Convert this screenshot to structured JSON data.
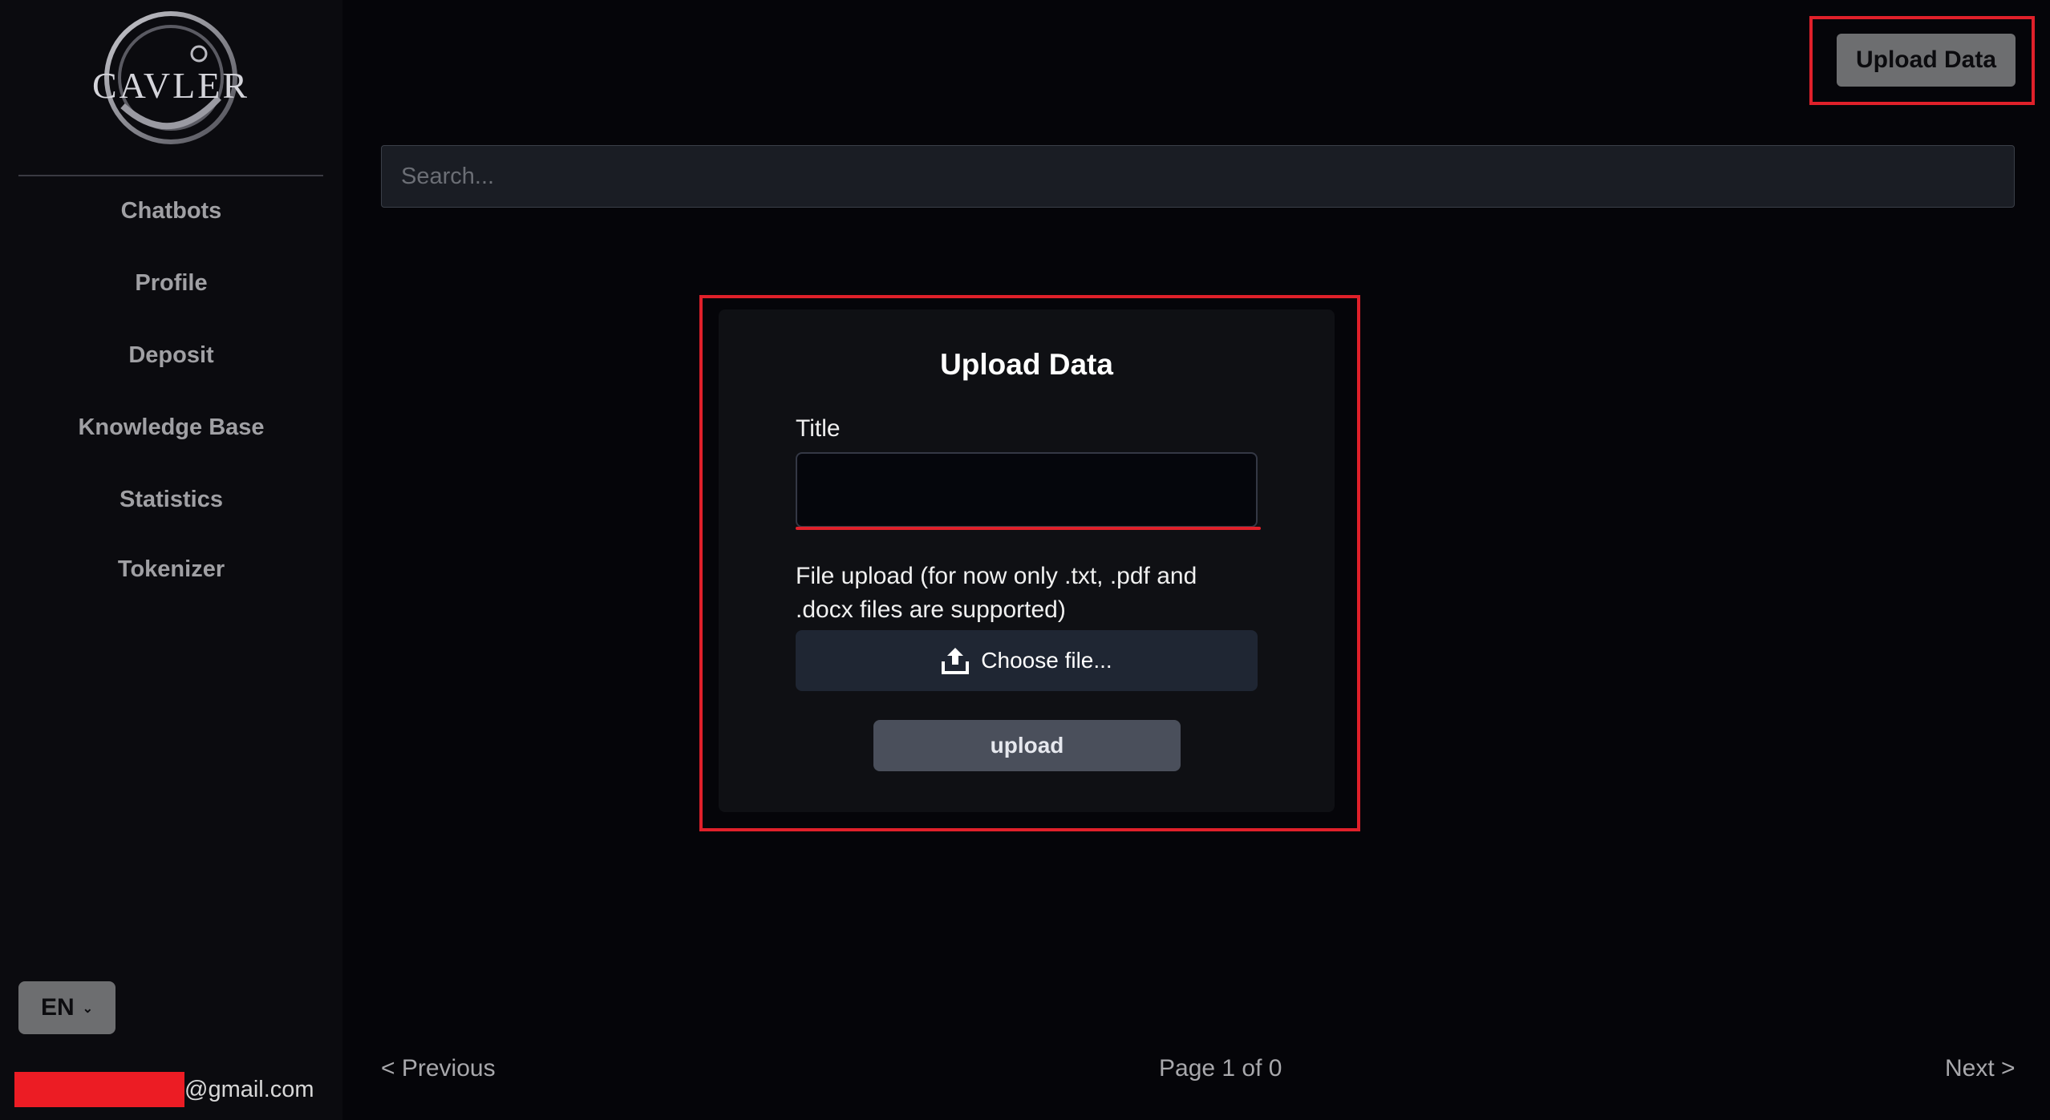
{
  "sidebar": {
    "logo_text": "CAVLER",
    "items": [
      {
        "label": "Chatbots"
      },
      {
        "label": "Profile"
      },
      {
        "label": "Deposit"
      },
      {
        "label": "Knowledge Base"
      },
      {
        "label": "Statistics"
      },
      {
        "label": "Tokenizer"
      }
    ],
    "language": "EN",
    "email_domain": "@gmail.com"
  },
  "header": {
    "upload_button_label": "Upload Data"
  },
  "search": {
    "placeholder": "Search..."
  },
  "modal": {
    "title": "Upload Data",
    "title_field_label": "Title",
    "title_field_value": "",
    "file_upload_label": "File upload (for now only .txt, .pdf and .docx files are supported)",
    "choose_file_label": "Choose file...",
    "upload_button_label": "upload"
  },
  "pagination": {
    "previous_label": "< Previous",
    "page_info": "Page 1 of 0",
    "next_label": "Next >"
  },
  "colors": {
    "annotation": "#e0202a",
    "background": "#050509",
    "sidebar": "#0b0b0f"
  }
}
